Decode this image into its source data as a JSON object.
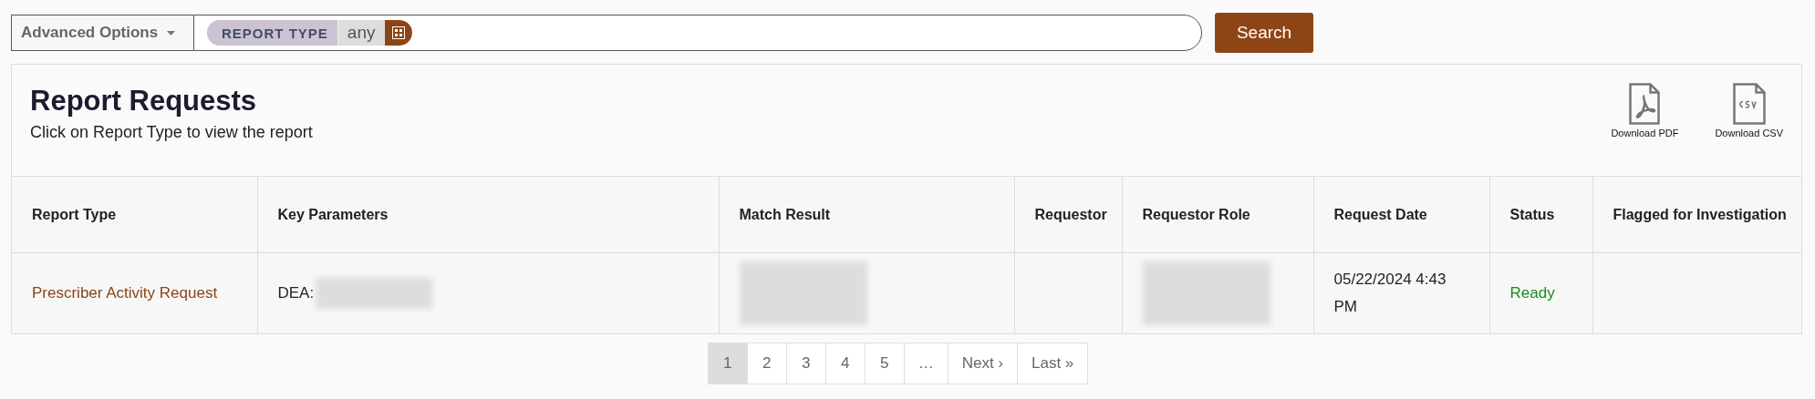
{
  "search_bar": {
    "advanced_options": "Advanced Options",
    "token": {
      "label": "REPORT TYPE",
      "value": "any"
    },
    "button": "Search"
  },
  "panel": {
    "title": "Report Requests",
    "subtitle": "Click on Report Type to view the report",
    "downloads": [
      {
        "kind": "pdf",
        "label": "Download PDF"
      },
      {
        "kind": "csv",
        "label": "Download CSV"
      }
    ]
  },
  "table": {
    "columns": [
      "Report Type",
      "Key Parameters",
      "Match Result",
      "Requestor",
      "Requestor Role",
      "Request Date",
      "Status",
      "Flagged for Investigation"
    ],
    "rows": [
      {
        "cells": [
          {
            "kind": "link",
            "text": "Prescriber Activity Request"
          },
          {
            "kind": "redacted_text",
            "text": "DEA:"
          },
          {
            "kind": "redacted"
          },
          {
            "kind": "empty"
          },
          {
            "kind": "redacted"
          },
          {
            "kind": "text",
            "text": "05/22/2024 4:43 PM"
          },
          {
            "kind": "status",
            "text": "Ready"
          },
          {
            "kind": "empty"
          }
        ]
      }
    ]
  },
  "pagination": [
    {
      "label": "1",
      "selected": true
    },
    {
      "label": "2",
      "selected": false
    },
    {
      "label": "3",
      "selected": false
    },
    {
      "label": "4",
      "selected": false
    },
    {
      "label": "5",
      "selected": false
    },
    {
      "label": "…",
      "selected": false
    },
    {
      "label": "Next ›",
      "selected": false
    },
    {
      "label": "Last »",
      "selected": false
    }
  ]
}
